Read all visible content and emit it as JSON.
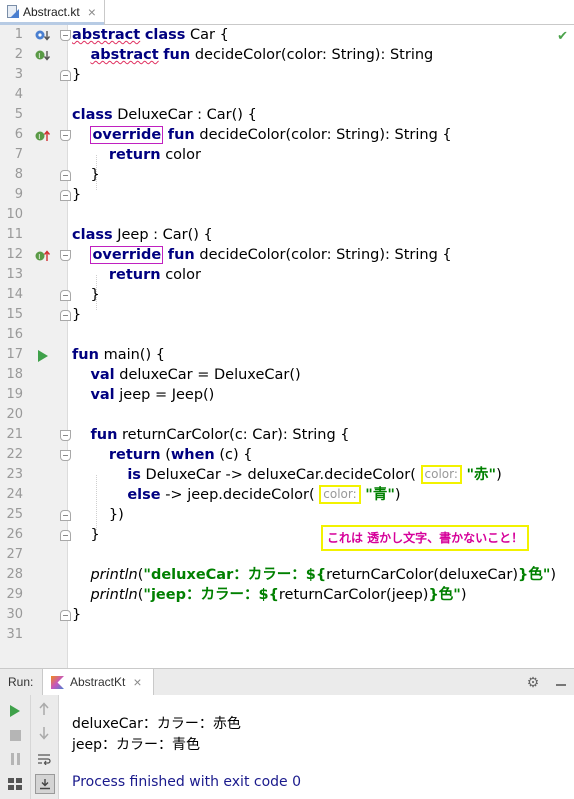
{
  "tab": {
    "file_name": "Abstract.kt",
    "close": "×"
  },
  "editor": {
    "lines": [
      {
        "n": "1"
      },
      {
        "n": "2"
      },
      {
        "n": "3"
      },
      {
        "n": "4"
      },
      {
        "n": "5"
      },
      {
        "n": "6"
      },
      {
        "n": "7"
      },
      {
        "n": "8"
      },
      {
        "n": "9"
      },
      {
        "n": "10"
      },
      {
        "n": "11"
      },
      {
        "n": "12"
      },
      {
        "n": "13"
      },
      {
        "n": "14"
      },
      {
        "n": "15"
      },
      {
        "n": "16"
      },
      {
        "n": "17"
      },
      {
        "n": "18"
      },
      {
        "n": "19"
      },
      {
        "n": "20"
      },
      {
        "n": "21"
      },
      {
        "n": "22"
      },
      {
        "n": "23"
      },
      {
        "n": "24"
      },
      {
        "n": "25"
      },
      {
        "n": "26"
      },
      {
        "n": "27"
      },
      {
        "n": "28"
      },
      {
        "n": "29"
      },
      {
        "n": "30"
      },
      {
        "n": "31"
      }
    ],
    "code": {
      "l1_kw1": "abstract",
      "l1_kw2": "class",
      "l1_rest": " Car {",
      "l2_kw1": "abstract",
      "l2_kw2": "fun",
      "l2_rest": " decideColor(color: String): String",
      "l3": "}",
      "l5_kw": "class",
      "l5_rest": " DeluxeCar : Car() {",
      "l6_kw1": "override",
      "l6_kw2": "fun",
      "l6_rest": " decideColor(color: String): String {",
      "l7_kw": "return",
      "l7_rest": " color",
      "l8": "}",
      "l9": "}",
      "l11_kw": "class",
      "l11_rest": " Jeep : Car() {",
      "l12_kw1": "override",
      "l12_kw2": "fun",
      "l12_rest": " decideColor(color: String): String {",
      "l13_kw": "return",
      "l13_rest": " color",
      "l14": "}",
      "l15": "}",
      "l17_kw": "fun",
      "l17_rest": " main() {",
      "l18_kw": "val",
      "l18_rest": " deluxeCar = DeluxeCar()",
      "l19_kw": "val",
      "l19_rest": " jeep = Jeep()",
      "l21_kw": "fun",
      "l21_rest": " returnCarColor(c: Car): String {",
      "l22_kw1": "return",
      "l22_mid": " (",
      "l22_kw2": "when",
      "l22_rest": " (c) {",
      "l23_kw": "is",
      "l23_mid": " DeluxeCar -> deluxeCar.decideColor( ",
      "l23_hint": "color:",
      "l23_str": "\"赤\"",
      "l23_end": ")",
      "l24_kw": "else",
      "l24_mid": " -> jeep.decideColor( ",
      "l24_hint": "color:",
      "l24_str": "\"青\"",
      "l24_end": ")",
      "l25": "})",
      "l26": "}",
      "l28_fn": "println",
      "l28_p": "(",
      "l28_s1": "\"deluxeCar：カラー：${",
      "l28_mid": "returnCarColor(deluxeCar)",
      "l28_s2": "}色\"",
      "l28_end": ")",
      "l29_fn": "println",
      "l29_p": "(",
      "l29_s1": "\"jeep：カラー：${",
      "l29_mid": "returnCarColor(jeep)",
      "l29_s2": "}色\"",
      "l29_end": ")",
      "l30": "}"
    },
    "watermark": "これは 透かし文字、書かないこと！"
  },
  "run": {
    "label": "Run:",
    "tab_label": "AbstractKt",
    "tab_close": "×",
    "output": [
      "deluxeCar：カラー：赤色",
      "jeep：カラー：青色",
      "",
      "Process finished with exit code 0"
    ]
  },
  "colors": {
    "keyword": "#000080",
    "string": "#008000",
    "watermark": "#d6009a",
    "hint_border": "#f2f200",
    "override_box": "#c020c0"
  }
}
